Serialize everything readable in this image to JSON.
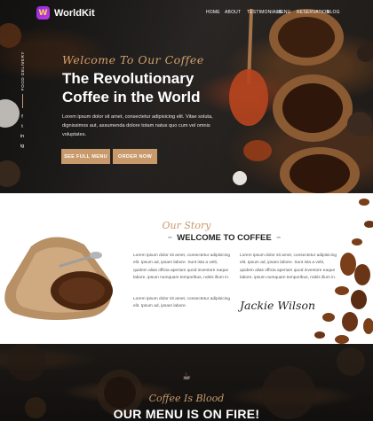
{
  "brand": {
    "name": "WorldKit",
    "badge": "W"
  },
  "nav": {
    "items": [
      "HOME",
      "ABOUT",
      "TESTIMONIALS",
      "MENU",
      "RESERVATION",
      "BLOG"
    ]
  },
  "social": {
    "label": "FOOD DELIVERY",
    "icons": [
      "f",
      "t",
      "in",
      "ig"
    ]
  },
  "hero": {
    "script": "Welcome To Our Coffee",
    "title": "The Revolutionary Coffee in the World",
    "description": "Lorem ipsum dolor sit amet, consectetur adipisicing elit. Vitae soluta, dignissimos aut, assumenda dolore totam natus quo cum vel omnis voluptates.",
    "btn_menu": "SEE FULL MENU",
    "btn_order": "ORDER NOW"
  },
  "story": {
    "script": "Our Story",
    "title": "WELCOME TO COFFEE",
    "para_left_1": "Lorem ipsum dolor sit amet, consectetur adipisicing elit. Ipsum ad, ipsam labore. Sunt ista a velit, quidem alias officia aperiam quod inventore eaque labore, ipsum numquam temporibus, nobis illum in.",
    "para_left_2": "Lorem ipsum dolor sit amet, consectetur adipisicing elit. Ipsum ad, ipsam labore.",
    "para_right": "Lorem ipsum dolor sit amet, consectetur adipisicing elit. Ipsum ad, ipsam labore. Sunt ista a velit, quidem alias officia aperiam quod inventore eaque labore, ipsum numquam temporibus, nobis illum in.",
    "signature": "Jackie Wilson"
  },
  "menu_section": {
    "script": "Coffee Is Blood",
    "title": "OUR MENU IS ON FIRE!"
  },
  "colors": {
    "accent": "#c8996a",
    "dark": "#1e1b18"
  }
}
